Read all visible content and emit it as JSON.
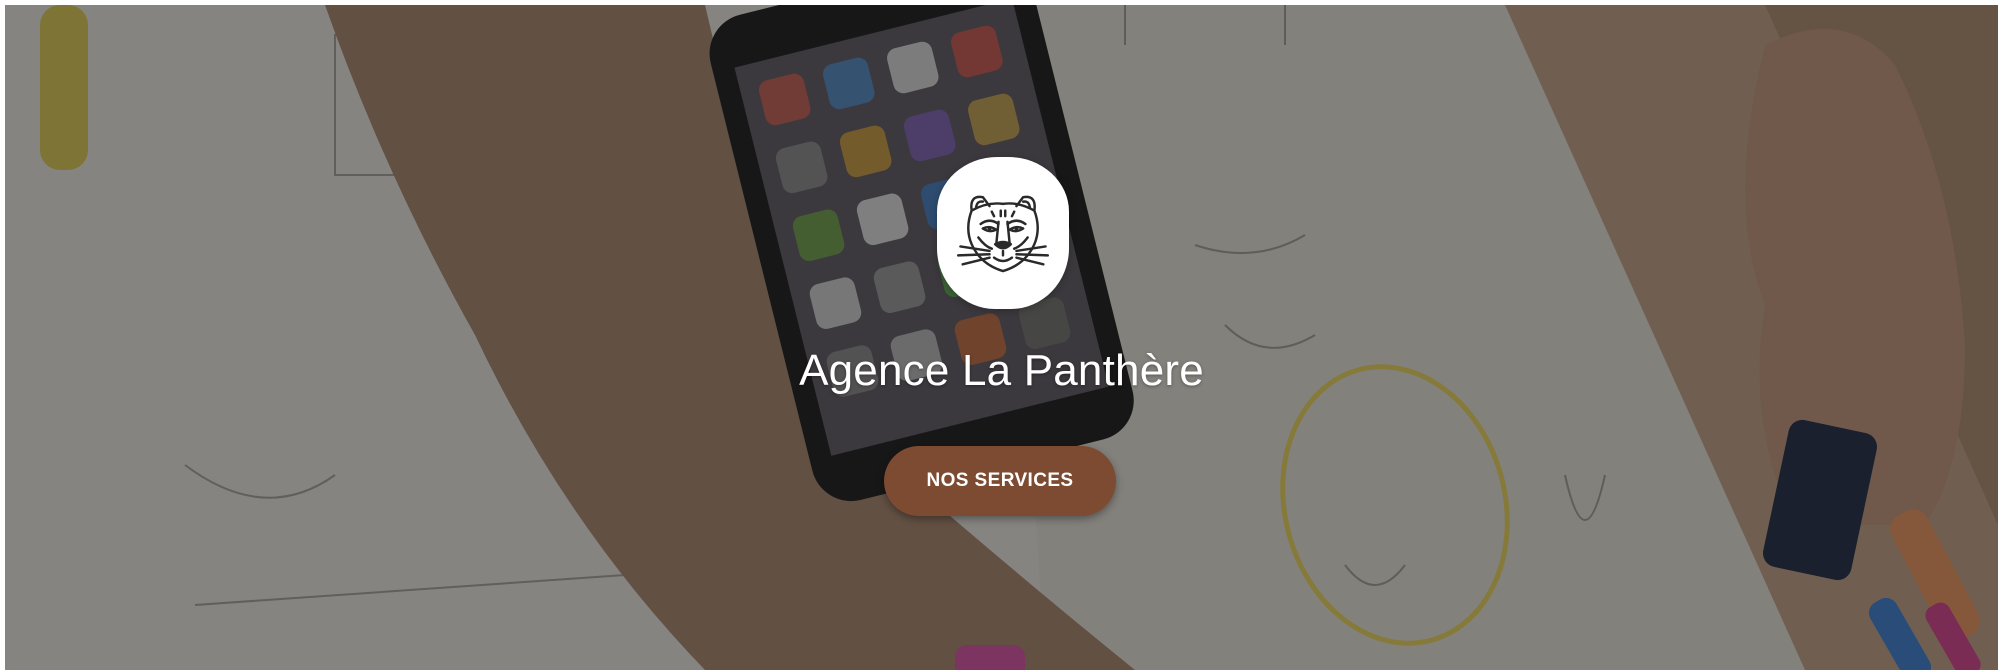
{
  "hero": {
    "title": "Agence La Panthère",
    "button_label": "NOS SERVICES",
    "logo_icon": "panther-head-icon",
    "background": "desk-sketches-photo",
    "colors": {
      "button": "#7d4b31",
      "title": "#ffffff",
      "overlay": "#14120f"
    }
  }
}
